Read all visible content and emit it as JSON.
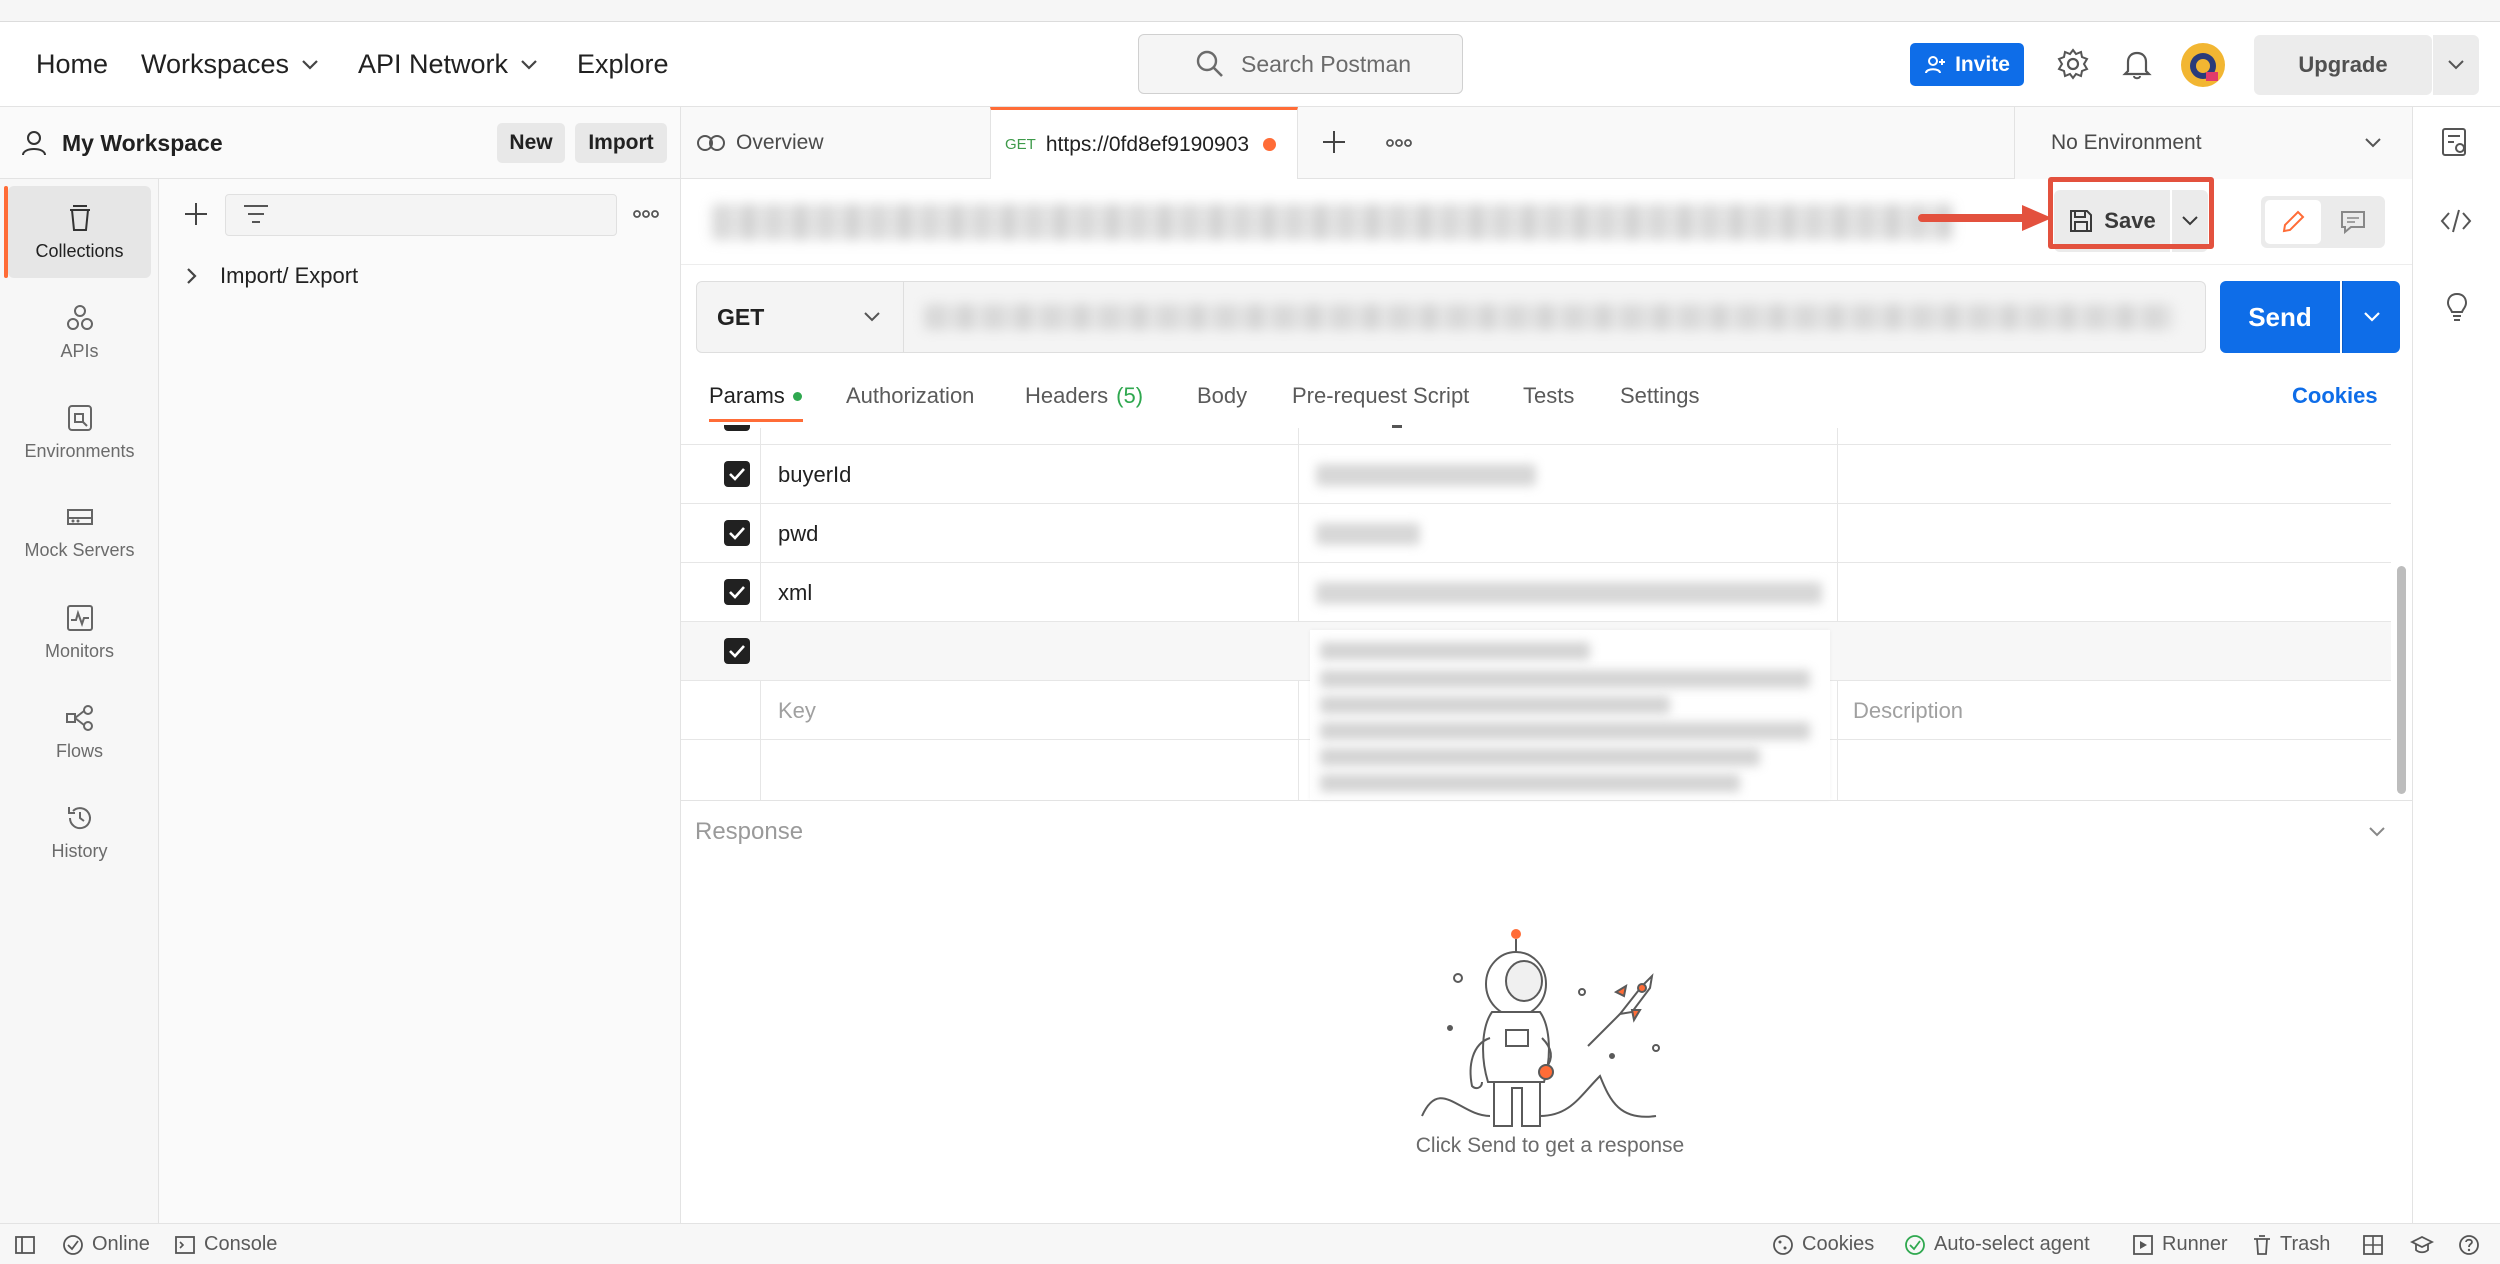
{
  "header": {
    "nav": [
      {
        "label": "Home"
      },
      {
        "label": "Workspaces"
      },
      {
        "label": "API Network"
      },
      {
        "label": "Explore"
      }
    ],
    "search_placeholder": "Search Postman",
    "invite_label": "Invite",
    "upgrade_label": "Upgrade"
  },
  "workspace": {
    "title": "My Workspace",
    "new_label": "New",
    "import_label": "Import"
  },
  "rail": {
    "items": [
      {
        "label": "Collections",
        "icon": "trash-can-icon"
      },
      {
        "label": "APIs",
        "icon": "apis-icon"
      },
      {
        "label": "Environments",
        "icon": "environments-icon"
      },
      {
        "label": "Mock Servers",
        "icon": "mock-server-icon"
      },
      {
        "label": "Monitors",
        "icon": "monitor-icon"
      },
      {
        "label": "Flows",
        "icon": "flows-icon"
      },
      {
        "label": "History",
        "icon": "history-icon"
      }
    ]
  },
  "collections": {
    "items": [
      {
        "label": "Import/ Export"
      }
    ]
  },
  "tabs": {
    "overview_label": "Overview",
    "active_method": "GET",
    "active_url": "https://0fd8ef9190903",
    "environment": "No Environment"
  },
  "request": {
    "save_label": "Save",
    "method": "GET",
    "send_label": "Send",
    "tabs": [
      {
        "label": "Params"
      },
      {
        "label": "Authorization"
      },
      {
        "label": "Headers",
        "count": "(5)"
      },
      {
        "label": "Body"
      },
      {
        "label": "Pre-request Script"
      },
      {
        "label": "Tests"
      },
      {
        "label": "Settings"
      }
    ],
    "cookies_label": "Cookies"
  },
  "params": {
    "rows": [
      {
        "key": "buyerId",
        "checked": true
      },
      {
        "key": "pwd",
        "checked": true
      },
      {
        "key": "xml",
        "checked": true
      },
      {
        "key": "",
        "checked": true
      }
    ],
    "key_placeholder": "Key",
    "description_placeholder": "Description"
  },
  "response": {
    "label": "Response",
    "hint": "Click Send to get a response"
  },
  "footer": {
    "online": "Online",
    "console": "Console",
    "cookies": "Cookies",
    "agent": "Auto-select agent",
    "runner": "Runner",
    "trash": "Trash"
  },
  "colors": {
    "accent_orange": "#ff6c37",
    "primary_blue": "#0e6de8",
    "highlight_red": "#e3513e"
  }
}
